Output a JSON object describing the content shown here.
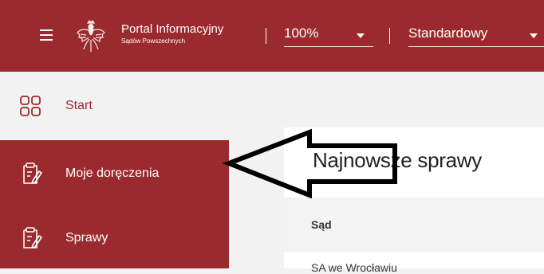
{
  "header": {
    "menu_icon": "hamburger-menu-icon",
    "logo_icon": "polish-eagle-emblem-icon",
    "brand_title": "Portal Informacyjny",
    "brand_subtitle": "Sądów Powszechnych",
    "zoom_value": "100%",
    "theme_value": "Standardowy",
    "accent_color": "#9b2a2e"
  },
  "sidebar": {
    "items": [
      {
        "label": "Start",
        "icon": "grid-icon"
      },
      {
        "label": "Moje doręczenia",
        "icon": "clipboard-edit-icon"
      },
      {
        "label": "Sprawy",
        "icon": "clipboard-edit-icon"
      }
    ]
  },
  "main": {
    "panel_title": "Najnowsze sprawy",
    "table": {
      "columns": [
        "Sąd"
      ],
      "rows": [
        [
          "SA we Wrocławiu"
        ]
      ]
    }
  },
  "annotation": {
    "icon": "pointer-arrow-annotation"
  }
}
